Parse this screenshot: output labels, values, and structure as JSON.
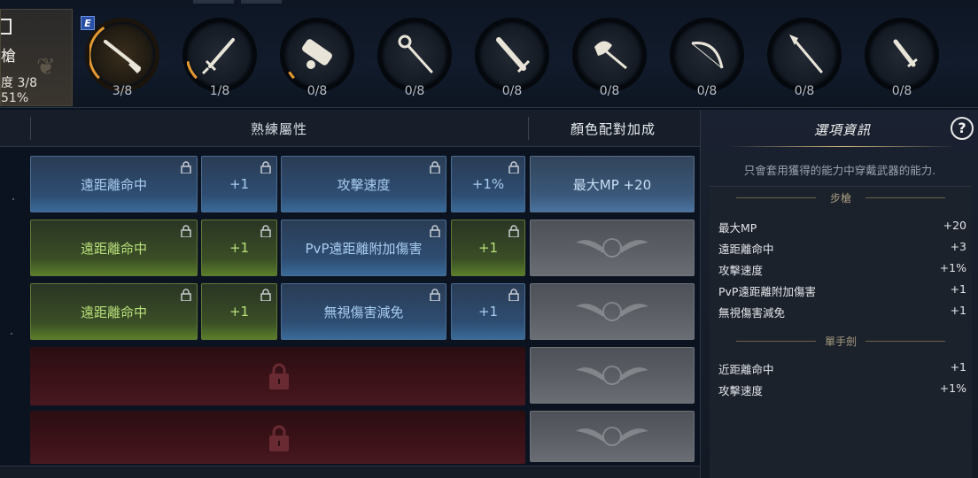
{
  "current_weapon": {
    "name": "槍",
    "level": "度 3/8",
    "percent": "51%"
  },
  "weapons": [
    {
      "icon": "musket-icon",
      "level": "3/8",
      "active": true,
      "progress": 0.375
    },
    {
      "icon": "sword-icon",
      "level": "1/8",
      "active": false,
      "progress": 0.125
    },
    {
      "icon": "cannon-icon",
      "level": "0/8",
      "active": false,
      "progress": 0.05
    },
    {
      "icon": "staff-icon",
      "level": "0/8",
      "active": false,
      "progress": 0
    },
    {
      "icon": "greatsword-icon",
      "level": "0/8",
      "active": false,
      "progress": 0
    },
    {
      "icon": "axe-icon",
      "level": "0/8",
      "active": false,
      "progress": 0
    },
    {
      "icon": "bow-icon",
      "level": "0/8",
      "active": false,
      "progress": 0
    },
    {
      "icon": "spear-icon",
      "level": "0/8",
      "active": false,
      "progress": 0
    },
    {
      "icon": "dagger-icon",
      "level": "0/8",
      "active": false,
      "progress": 0
    }
  ],
  "equipped_badge": "E",
  "headers": {
    "mastery": "熟練屬性",
    "color_bonus": "顏色配對加成"
  },
  "rows": [
    {
      "stat1": "遠距離命中",
      "val1": "+1",
      "stat2": "攻擊速度",
      "val2": "+1%",
      "color": "blue",
      "color_bonus": "最大MP +20"
    },
    {
      "stat1": "遠距離命中",
      "val1": "+1",
      "stat2": "PvP遠距離附加傷害",
      "val2": "+1",
      "color": "green",
      "color_bonus": ""
    },
    {
      "stat1": "遠距離命中",
      "val1": "+1",
      "stat2": "無視傷害減免",
      "val2": "+1",
      "color": "mixed",
      "color_bonus": ""
    }
  ],
  "info": {
    "title": "選項資訊",
    "help": "?",
    "description": "只會套用獲得的能力中穿戴武器的能力.",
    "groups": [
      {
        "name": "步槍",
        "stats": [
          {
            "name": "最大MP",
            "value": "+20"
          },
          {
            "name": "遠距離命中",
            "value": "+3"
          },
          {
            "name": "攻擊速度",
            "value": "+1%"
          },
          {
            "name": "PvP遠距離附加傷害",
            "value": "+1"
          },
          {
            "name": "無視傷害減免",
            "value": "+1"
          }
        ]
      },
      {
        "name": "單手劍",
        "stats": [
          {
            "name": "近距離命中",
            "value": "+1"
          },
          {
            "name": "攻擊速度",
            "value": "+1%"
          }
        ]
      }
    ]
  }
}
